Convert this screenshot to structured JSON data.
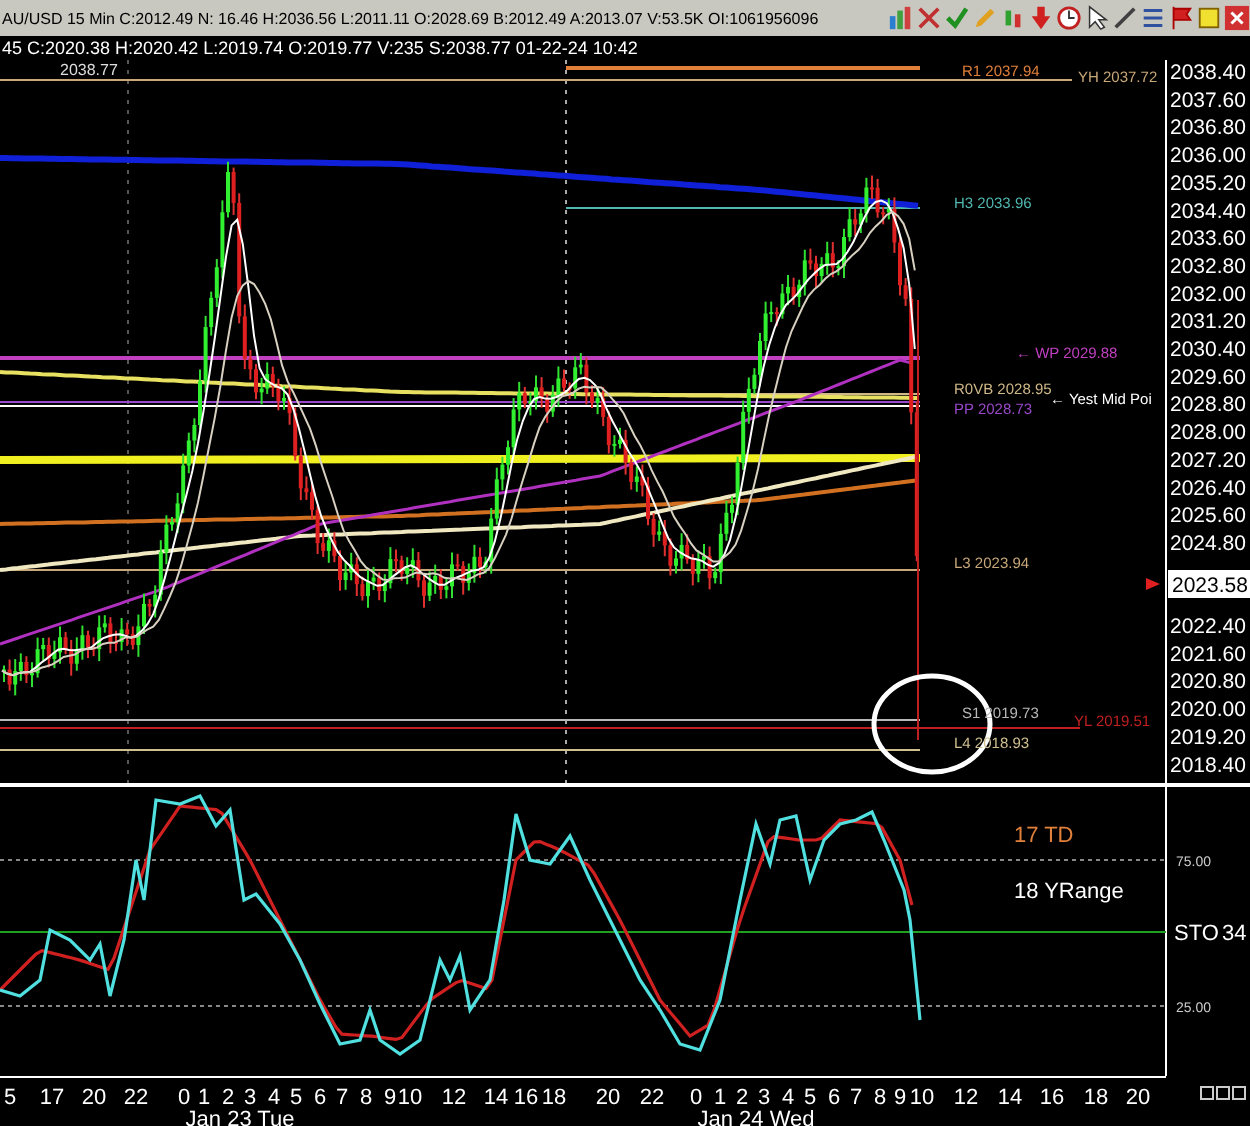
{
  "header": {
    "symbol_info": "AU/USD 15 Min C:2012.49 N: 16.46 H:2036.56 L:2011.11 O:2028.69 B:2012.49 A:2013.07 V:53.5K OI:1061956096",
    "bar_info": "45 C:2020.38 H:2020.42 L:2019.74 O:2019.77 V:235 S:2038.77 01-22-24 10:42"
  },
  "price_chart": {
    "high_marker": "2038.77",
    "current_price": "2023.58",
    "price_axis": [
      "2038.40",
      "2037.60",
      "2036.80",
      "2036.00",
      "2035.20",
      "2034.40",
      "2033.60",
      "2032.80",
      "2032.00",
      "2031.20",
      "2030.40",
      "2029.60",
      "2028.80",
      "2028.00",
      "2027.20",
      "2026.40",
      "2025.60",
      "2024.80",
      "2022.40",
      "2021.60",
      "2020.80",
      "2020.00",
      "2019.20",
      "2018.40"
    ],
    "levels": [
      {
        "label": "R1 2037.94",
        "color": "#e0803a"
      },
      {
        "label": "YH 2037.72",
        "color": "#c8a878"
      },
      {
        "label": "H3 2033.96",
        "color": "#50b8b0"
      },
      {
        "label": "← WP 2029.88",
        "color": "#c040c0"
      },
      {
        "label": "R0VB 2028.95",
        "color": "#d0b888"
      },
      {
        "label": "PP 2028.73",
        "color": "#9848c8"
      },
      {
        "label": "← Yest Mid Poi",
        "color": "#ffffff"
      },
      {
        "label": "L3 2023.94",
        "color": "#c8a878"
      },
      {
        "label": "S1 2019.73",
        "color": "#b8b8b8"
      },
      {
        "label": "YL 2019.51",
        "color": "#c02020"
      },
      {
        "label": "L4 2018.93",
        "color": "#d0c090"
      }
    ]
  },
  "oscillator": {
    "legend": [
      {
        "label": "17 TD",
        "color": "#e0803a"
      },
      {
        "label": "18 YRange",
        "color": "#ffffff"
      }
    ],
    "indicator": "STO",
    "value": "34",
    "ticks": [
      "75.00",
      "25.00"
    ]
  },
  "time_axis": {
    "hours": [
      "5",
      "17",
      "20",
      "22",
      "0",
      "1",
      "2",
      "3",
      "4",
      "5",
      "6",
      "7",
      "8",
      "9",
      "10",
      "12",
      "14",
      "16",
      "18",
      "20",
      "22",
      "0",
      "1",
      "2",
      "3",
      "4",
      "5",
      "6",
      "7",
      "8",
      "9",
      "10",
      "12",
      "14",
      "16",
      "18",
      "20"
    ],
    "dates": [
      "Jan 23 Tue",
      "Jan 24 Wed"
    ]
  }
}
